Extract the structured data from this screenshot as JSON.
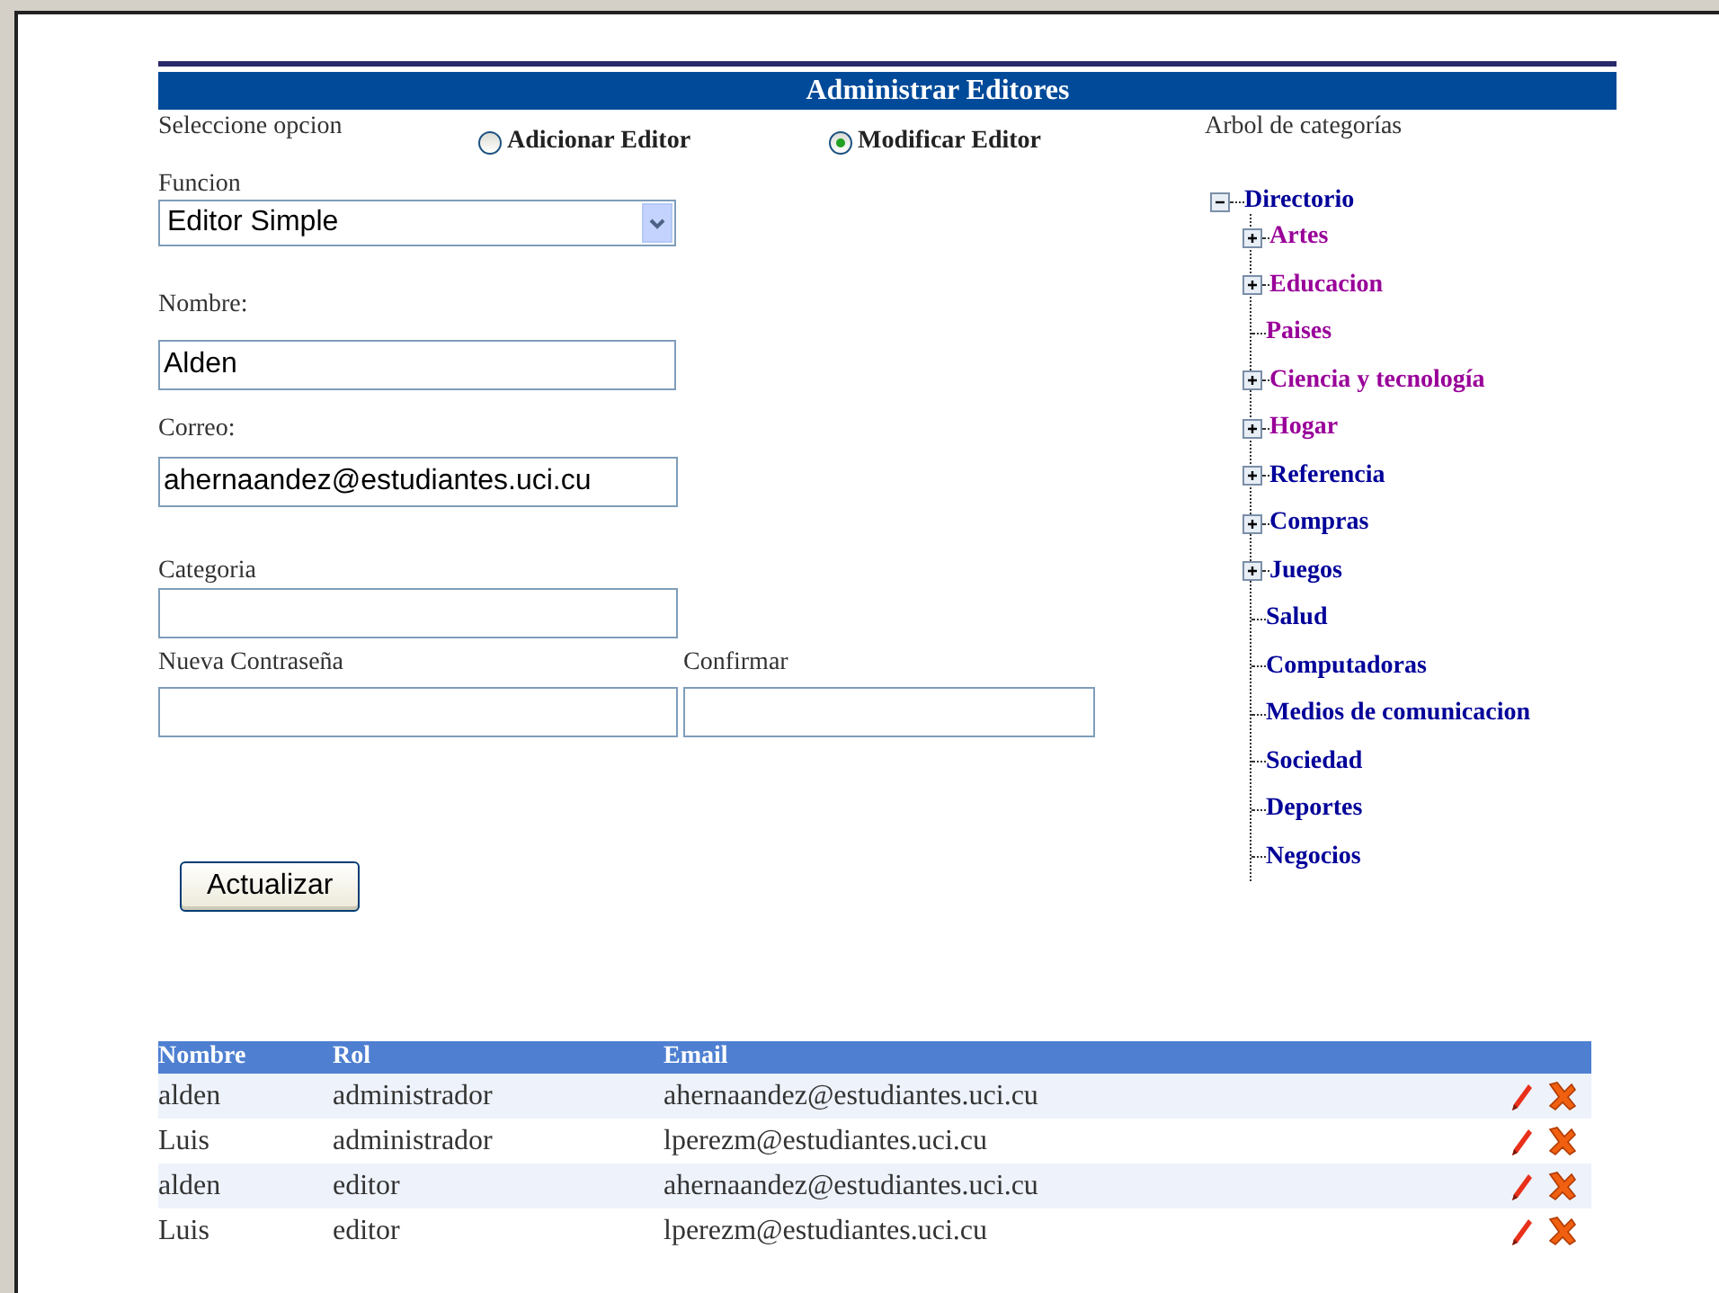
{
  "title": "Administrar Editores",
  "option": {
    "label": "Seleccione opcion",
    "choices": [
      {
        "label": "Adicionar Editor",
        "selected": false
      },
      {
        "label": "Modificar Editor",
        "selected": true
      }
    ]
  },
  "funcion": {
    "label": "Funcion",
    "value": "Editor Simple"
  },
  "nombre": {
    "label": "Nombre:",
    "value": "Alden"
  },
  "correo": {
    "label": "Correo:",
    "value": "ahernaandez@estudiantes.uci.cu"
  },
  "categoria": {
    "label": "Categoria"
  },
  "password": {
    "label": "Nueva Contraseña"
  },
  "confirm": {
    "label": "Confirmar"
  },
  "button": "Actualizar",
  "tree": {
    "label": "Arbol de categorías",
    "root": {
      "label": "Directorio",
      "expanded": true,
      "children": [
        {
          "label": "Artes",
          "expandable": true,
          "color": "#990099"
        },
        {
          "label": "Educacion",
          "expandable": true,
          "color": "#990099"
        },
        {
          "label": "Paises",
          "expandable": false,
          "color": "#990099"
        },
        {
          "label": "Ciencia y tecnología",
          "expandable": true,
          "color": "#990099"
        },
        {
          "label": "Hogar",
          "expandable": true,
          "color": "#990099"
        },
        {
          "label": "Referencia",
          "expandable": true,
          "color": "#000099"
        },
        {
          "label": "Compras",
          "expandable": true,
          "color": "#000099"
        },
        {
          "label": "Juegos",
          "expandable": true,
          "color": "#000099"
        },
        {
          "label": "Salud",
          "expandable": false,
          "color": "#000099"
        },
        {
          "label": "Computadoras",
          "expandable": false,
          "color": "#000099"
        },
        {
          "label": "Medios de comunicacion",
          "expandable": false,
          "color": "#000099"
        },
        {
          "label": "Sociedad",
          "expandable": false,
          "color": "#000099"
        },
        {
          "label": "Deportes",
          "expandable": false,
          "color": "#000099"
        },
        {
          "label": "Negocios",
          "expandable": false,
          "color": "#000099"
        }
      ]
    }
  },
  "table": {
    "columns": [
      "Nombre",
      "Rol",
      "Email"
    ],
    "rows": [
      [
        "alden",
        "administrador",
        "ahernaandez@estudiantes.uci.cu"
      ],
      [
        "Luis",
        "administrador",
        "lperezm@estudiantes.uci.cu"
      ],
      [
        "alden",
        "editor",
        "ahernaandez@estudiantes.uci.cu"
      ],
      [
        "Luis",
        "editor",
        "lperezm@estudiantes.uci.cu"
      ]
    ]
  }
}
